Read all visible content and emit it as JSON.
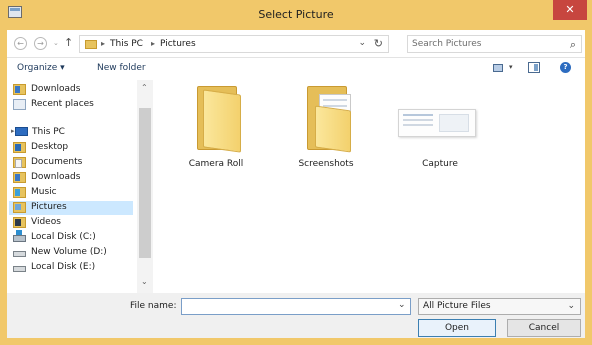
{
  "window": {
    "title": "Select Picture",
    "close_glyph": "✕"
  },
  "nav": {
    "back_glyph": "←",
    "forward_glyph": "→",
    "recent_drop_glyph": "⌄",
    "up_glyph": "↑",
    "breadcrumb": [
      "This PC",
      "Pictures"
    ],
    "breadcrumb_sep": "▸",
    "address_drop_glyph": "⌄",
    "refresh_glyph": "↻"
  },
  "search": {
    "placeholder": "Search Pictures",
    "icon_glyph": "⌕"
  },
  "toolbar": {
    "organize": "Organize ▾",
    "new_folder": "New folder",
    "views_drop_glyph": "▾",
    "help_glyph": "?"
  },
  "tree": {
    "items": [
      {
        "label": "Downloads",
        "icon": "downloads-icon"
      },
      {
        "label": "Recent places",
        "icon": "recent-places-icon"
      },
      {
        "label": "This PC",
        "icon": "computer-icon"
      },
      {
        "label": "Desktop",
        "icon": "desktop-icon"
      },
      {
        "label": "Documents",
        "icon": "documents-icon"
      },
      {
        "label": "Downloads",
        "icon": "downloads-icon"
      },
      {
        "label": "Music",
        "icon": "music-icon"
      },
      {
        "label": "Pictures",
        "icon": "pictures-icon",
        "selected": true
      },
      {
        "label": "Videos",
        "icon": "videos-icon"
      },
      {
        "label": "Local Disk (C:)",
        "icon": "disk-icon"
      },
      {
        "label": "New Volume (D:)",
        "icon": "drive-icon"
      },
      {
        "label": "Local Disk (E:)",
        "icon": "drive-icon"
      }
    ],
    "expand_glyph": "▸",
    "scroll_up_glyph": "⌃",
    "scroll_down_glyph": "⌄"
  },
  "files": [
    {
      "name": "Camera Roll",
      "kind": "folder"
    },
    {
      "name": "Screenshots",
      "kind": "folder-with-documents"
    },
    {
      "name": "Capture",
      "kind": "image-thumbnail"
    }
  ],
  "bottom": {
    "filename_label": "File name:",
    "filename_value": "",
    "filename_drop_glyph": "⌄",
    "filetype": "All Picture Files",
    "filetype_drop_glyph": "⌄",
    "open": "Open",
    "cancel": "Cancel"
  },
  "colors": {
    "titlebar": "#f1c86a",
    "close": "#c7463f",
    "selection": "#cce8ff",
    "folder": "#e7c35e"
  }
}
